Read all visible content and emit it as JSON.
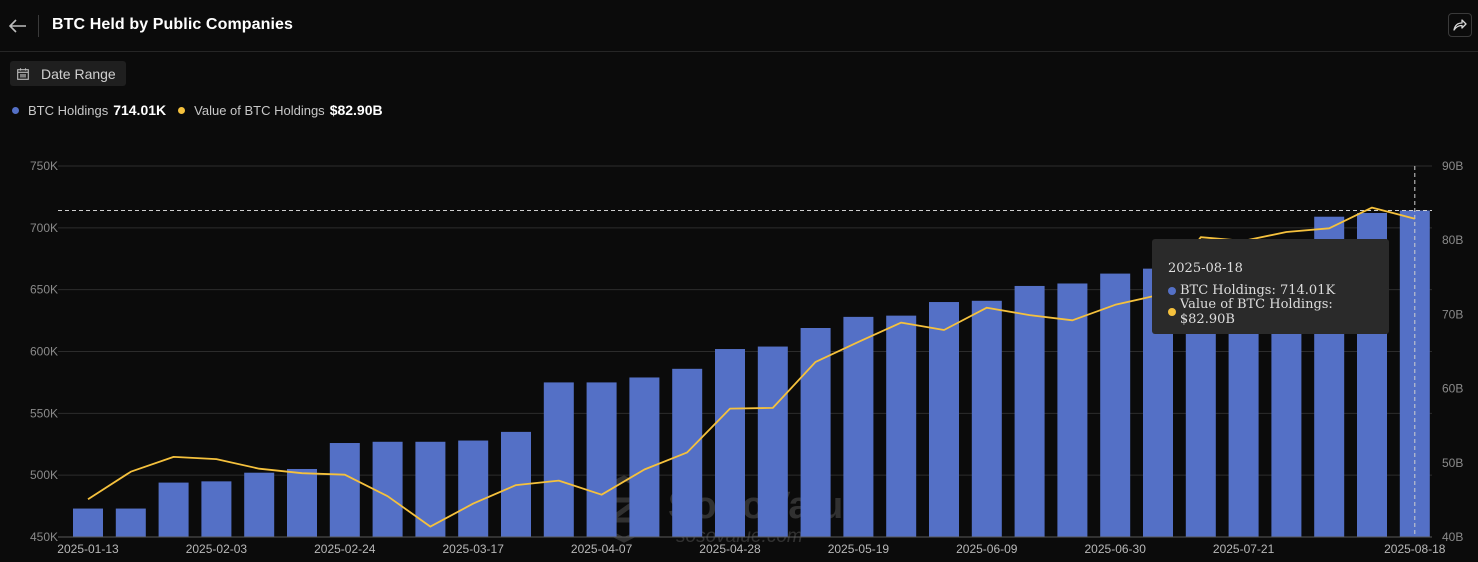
{
  "header": {
    "title": "BTC Held by Public Companies"
  },
  "toolbar": {
    "date_range_label": "Date Range"
  },
  "legend": {
    "items": [
      {
        "label": "BTC Holdings",
        "value": "714.01K",
        "color": "#5470c6"
      },
      {
        "label": "Value of BTC Holdings",
        "value": "$82.90B",
        "color": "#f5c13d"
      }
    ]
  },
  "tooltip": {
    "date": "2025-08-18",
    "rows": [
      {
        "label": "BTC Holdings: 714.01K",
        "color": "#5470c6"
      },
      {
        "label": "Value of BTC Holdings: $82.90B",
        "color": "#f5c13d"
      }
    ]
  },
  "watermark": {
    "name": "SoSoValue",
    "url": "sosovalue.com"
  },
  "chart_data": {
    "type": "bar",
    "title": "BTC Held by Public Companies",
    "x_tick_labels": [
      "2025-01-13",
      "2025-02-03",
      "2025-02-24",
      "2025-03-17",
      "2025-04-07",
      "2025-04-28",
      "2025-05-19",
      "2025-06-09",
      "2025-06-30",
      "2025-07-21",
      "2025-08-18"
    ],
    "y_left": {
      "ylim": [
        450,
        750
      ],
      "ticks": [
        "450K",
        "500K",
        "550K",
        "600K",
        "650K",
        "700K",
        "750K"
      ]
    },
    "y_right": {
      "ylim": [
        40,
        90
      ],
      "ticks": [
        "40B",
        "50B",
        "60B",
        "70B",
        "80B",
        "90B"
      ]
    },
    "grid": true,
    "series": [
      {
        "name": "BTC Holdings",
        "type": "bar",
        "unit": "K BTC",
        "axis": "left",
        "values": [
          473,
          473,
          494,
          495,
          502,
          505,
          526,
          527,
          527,
          528,
          535,
          575,
          575,
          579,
          586,
          602,
          604,
          619,
          628,
          629,
          640,
          641,
          653,
          655,
          663,
          667,
          668,
          683,
          684,
          709,
          712,
          714.01
        ]
      },
      {
        "name": "Value of BTC Holdings",
        "type": "line",
        "unit": "B USD",
        "axis": "right",
        "values": [
          45.1,
          48.8,
          50.8,
          50.5,
          49.2,
          48.6,
          48.4,
          45.5,
          41.4,
          44.5,
          47.0,
          47.6,
          45.7,
          49.1,
          51.4,
          57.3,
          57.4,
          63.6,
          66.3,
          68.9,
          67.9,
          70.9,
          69.9,
          69.2,
          71.3,
          72.6,
          80.4,
          79.9,
          81.1,
          81.6,
          84.4,
          82.9
        ]
      }
    ],
    "highlight": {
      "date": "2025-08-18",
      "btc_holdings": 714.01,
      "value_b": 82.9
    }
  }
}
